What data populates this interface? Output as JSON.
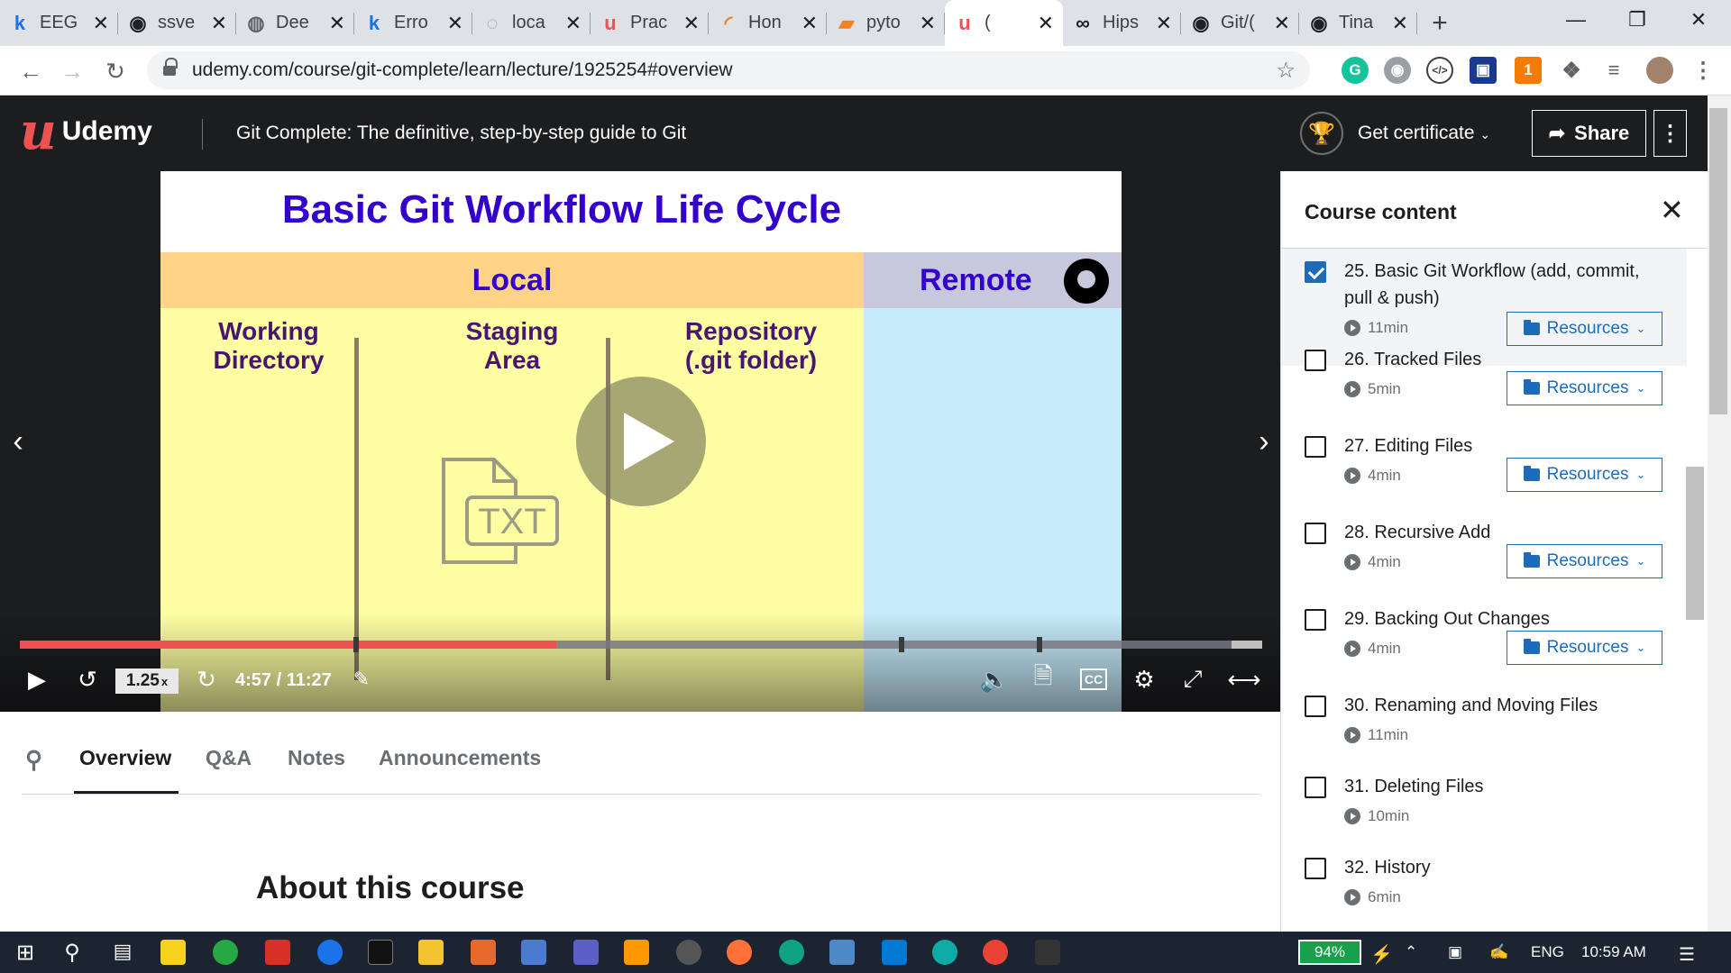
{
  "browser": {
    "tabs": [
      {
        "title": "EEG",
        "icon": "k-icon",
        "color": "#1a73e8",
        "glyph": "k"
      },
      {
        "title": "ssve",
        "icon": "github-icon",
        "color": "#202124",
        "glyph": "◉"
      },
      {
        "title": "Dee",
        "icon": "globe-icon",
        "color": "#5f6368",
        "glyph": "◍"
      },
      {
        "title": "Erro",
        "icon": "k-icon",
        "color": "#1a73e8",
        "glyph": "k"
      },
      {
        "title": "loca",
        "icon": "loading-icon",
        "color": "#9aa0a6",
        "glyph": "◌"
      },
      {
        "title": "Prac",
        "icon": "udemy-icon",
        "color": "#ec5252",
        "glyph": "u"
      },
      {
        "title": "Hon",
        "icon": "spinner-icon",
        "color": "#f48024",
        "glyph": "◜"
      },
      {
        "title": "pyto",
        "icon": "book-icon",
        "color": "#f48024",
        "glyph": "▰"
      },
      {
        "title": "(",
        "icon": "udemy-icon",
        "color": "#ec5252",
        "glyph": "u",
        "active": true
      },
      {
        "title": "Hips",
        "icon": "link-icon",
        "color": "#202124",
        "glyph": "∞"
      },
      {
        "title": "Git/(",
        "icon": "github-icon",
        "color": "#202124",
        "glyph": "◉"
      },
      {
        "title": "Tina",
        "icon": "github-icon",
        "color": "#202124",
        "glyph": "◉"
      }
    ],
    "url": "udemy.com/course/git-complete/learn/lecture/1925254#overview"
  },
  "header": {
    "logo": "Udemy",
    "course_title": "Git Complete: The definitive, step-by-step guide to Git",
    "certificate": "Get certificate",
    "share": "Share"
  },
  "slide": {
    "title": "Basic Git Workflow Life Cycle",
    "local": "Local",
    "remote": "Remote",
    "working_directory": "Working Directory",
    "staging_area": "Staging Area",
    "repository": "Repository (.git folder)",
    "file_label": "TXT"
  },
  "player": {
    "speed": "1.25",
    "speed_suffix": "x",
    "time": "4:57 / 11:27",
    "progress": 0.432,
    "buffered": 0.976
  },
  "lecture_tabs": [
    "Overview",
    "Q&A",
    "Notes",
    "Announcements"
  ],
  "about_heading": "About this course",
  "sidebar": {
    "title": "Course content",
    "lectures": [
      {
        "title": "25. Basic Git Workflow (add, commit, pull & push)",
        "duration": "11min",
        "checked": true,
        "resources": true
      },
      {
        "title": "26. Tracked Files",
        "duration": "5min",
        "checked": false,
        "resources": true
      },
      {
        "title": "27. Editing Files",
        "duration": "4min",
        "checked": false,
        "resources": true
      },
      {
        "title": "28. Recursive Add",
        "duration": "4min",
        "checked": false,
        "resources": true
      },
      {
        "title": "29. Backing Out Changes",
        "duration": "4min",
        "checked": false,
        "resources": true
      },
      {
        "title": "30. Renaming and Moving Files",
        "duration": "11min",
        "checked": false,
        "resources": false
      },
      {
        "title": "31. Deleting Files",
        "duration": "10min",
        "checked": false,
        "resources": false
      },
      {
        "title": "32. History",
        "duration": "6min",
        "checked": false,
        "resources": false
      }
    ],
    "resources_label": "Resources"
  },
  "taskbar": {
    "battery": "94%",
    "language": "ENG",
    "time": "10:59 AM"
  },
  "colors": {
    "udemy_red": "#ec5252",
    "udemy_dark": "#1c1d1f",
    "link_blue": "#1c6cbb",
    "slide_title": "#3300cc"
  }
}
